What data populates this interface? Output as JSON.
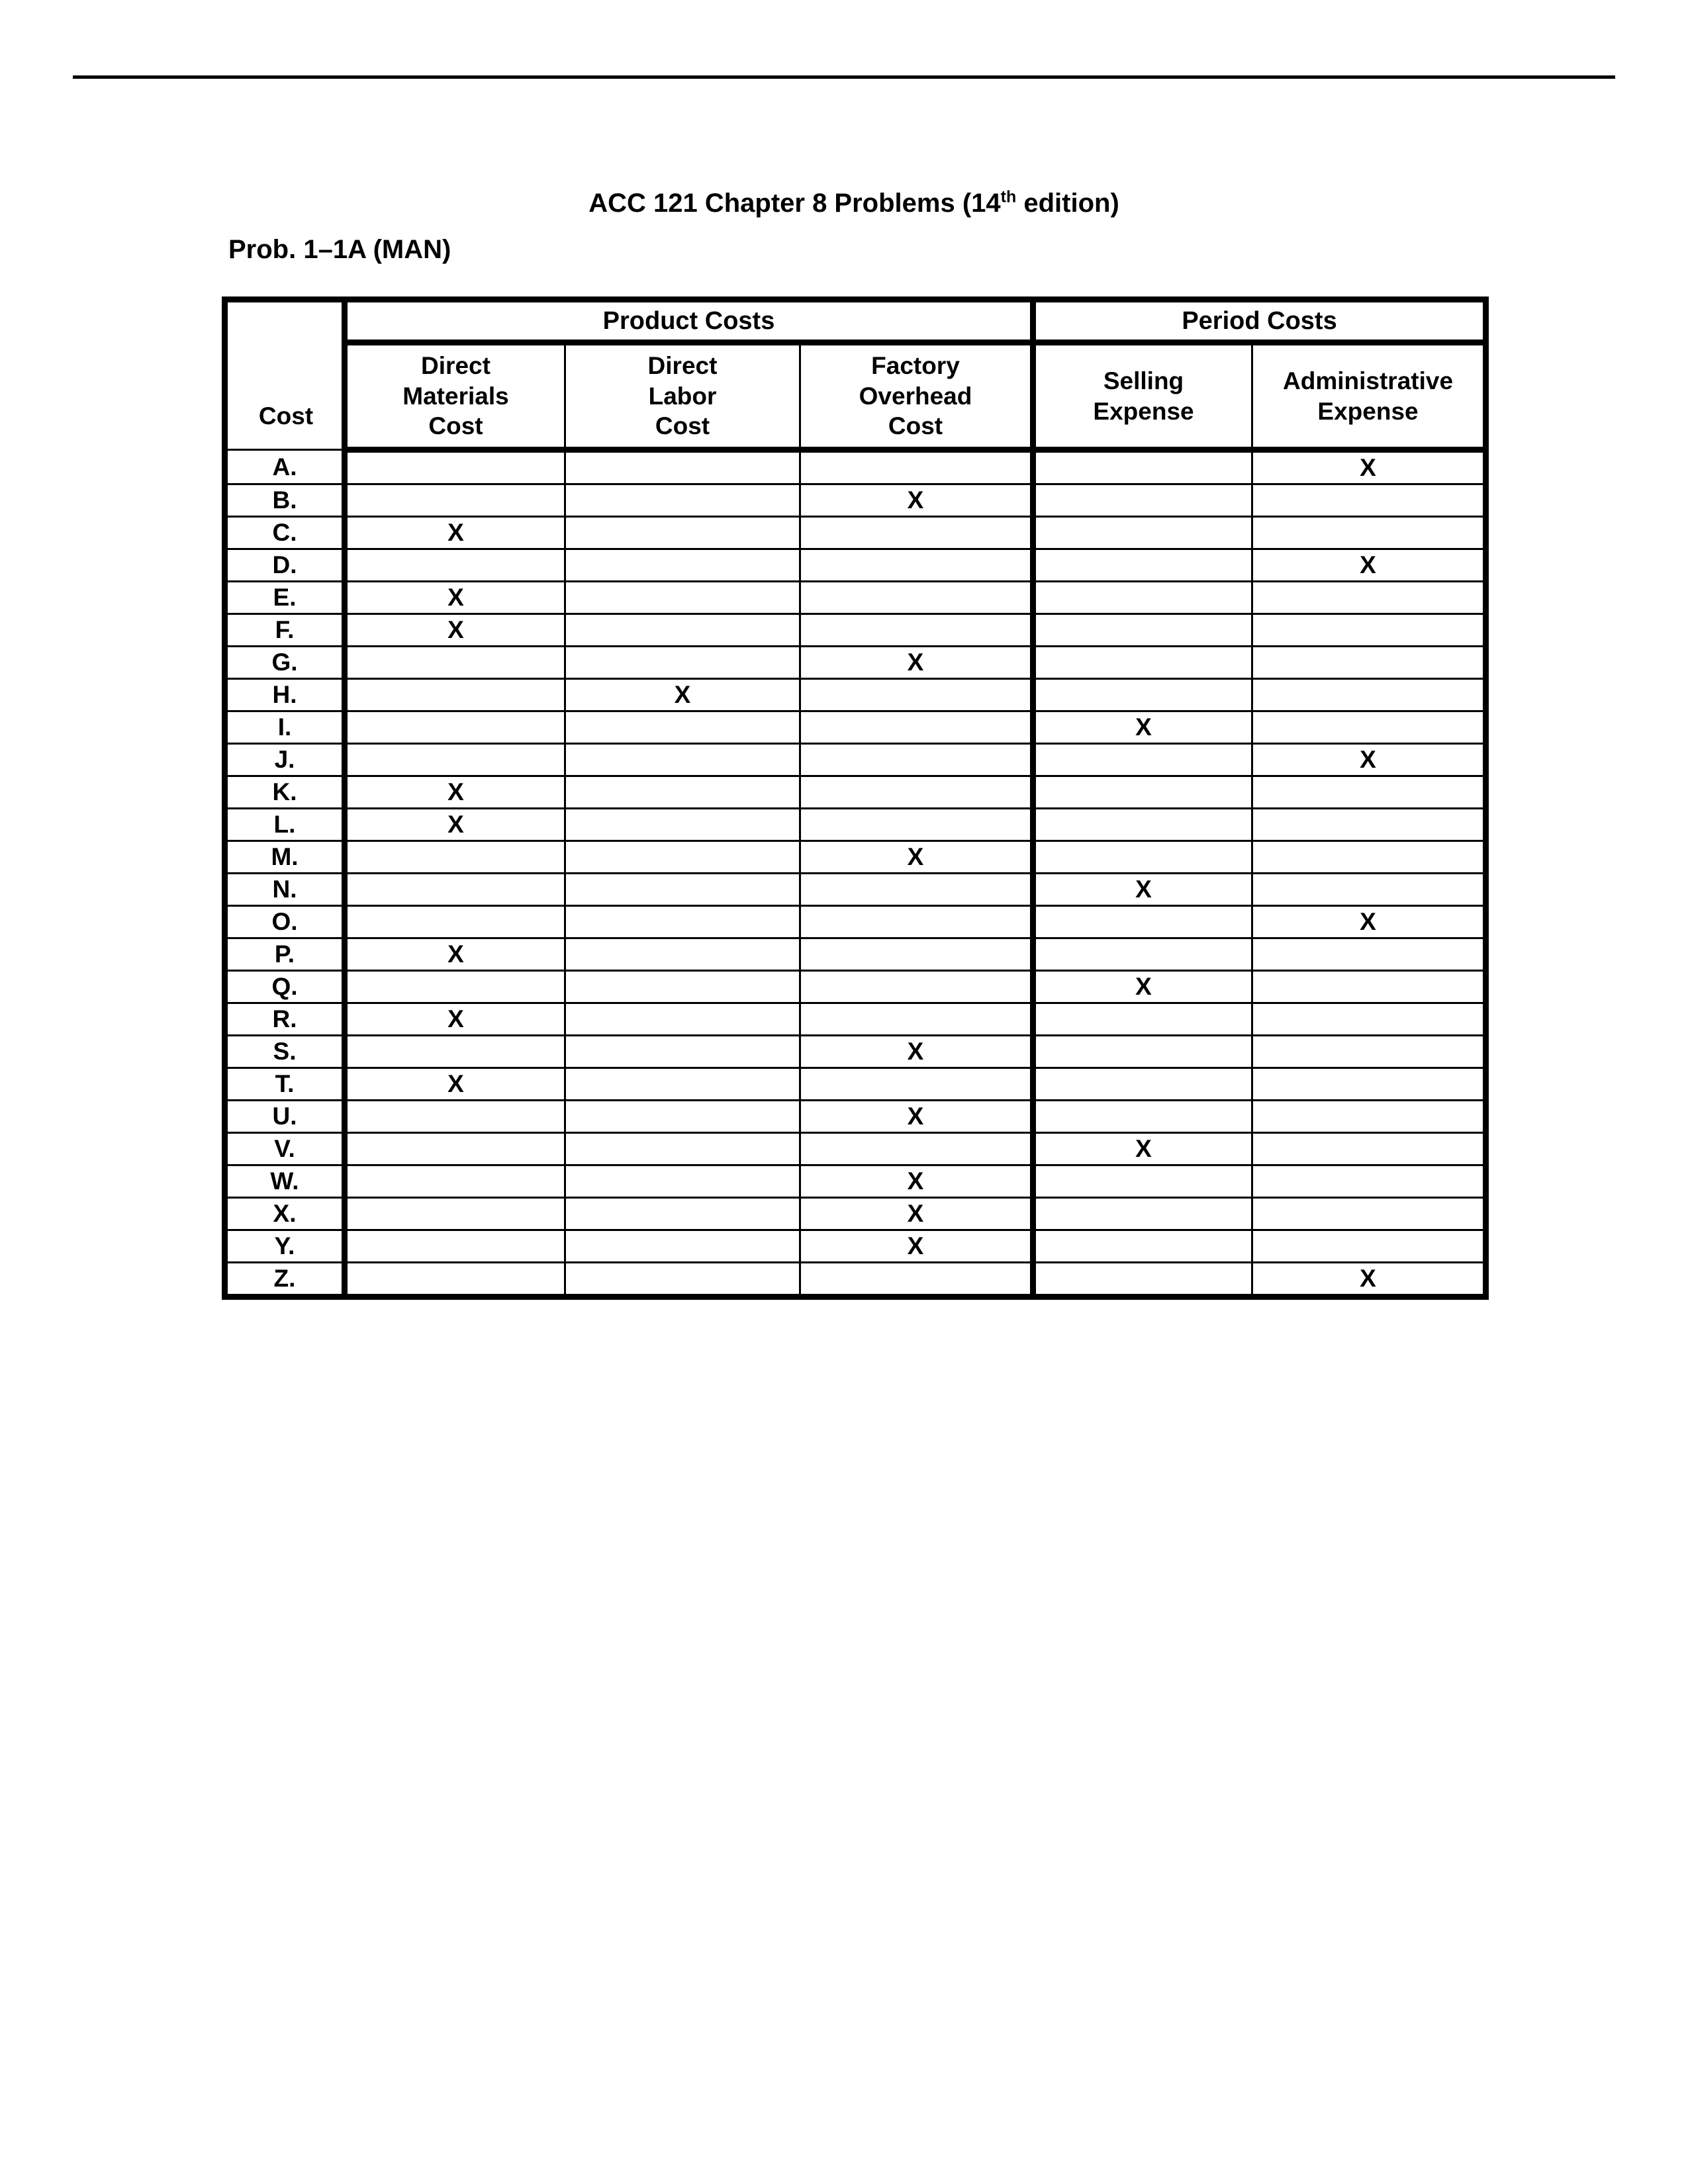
{
  "document": {
    "title_prefix": "ACC 121 Chapter 8 Problems (14",
    "title_superscript": "th",
    "title_suffix": " edition)",
    "problem_label": "Prob. 1–1A (MAN)"
  },
  "table": {
    "group_headers": {
      "corner": "",
      "product_costs": "Product Costs",
      "period_costs": "Period Costs"
    },
    "column_headers": {
      "cost": "Cost",
      "direct_materials": [
        "Direct",
        "Materials",
        "Cost"
      ],
      "direct_labor": [
        "Direct",
        "Labor",
        "Cost"
      ],
      "factory_overhead": [
        "Factory",
        "Overhead",
        "Cost"
      ],
      "selling_expense": [
        "Selling",
        "Expense"
      ],
      "administrative_expense": [
        "Administrative",
        "Expense"
      ]
    },
    "mark": "X",
    "rows": [
      {
        "label": "A.",
        "direct_materials": "",
        "direct_labor": "",
        "factory_overhead": "",
        "selling_expense": "",
        "administrative_expense": "X"
      },
      {
        "label": "B.",
        "direct_materials": "",
        "direct_labor": "",
        "factory_overhead": "X",
        "selling_expense": "",
        "administrative_expense": ""
      },
      {
        "label": "C.",
        "direct_materials": "X",
        "direct_labor": "",
        "factory_overhead": "",
        "selling_expense": "",
        "administrative_expense": ""
      },
      {
        "label": "D.",
        "direct_materials": "",
        "direct_labor": "",
        "factory_overhead": "",
        "selling_expense": "",
        "administrative_expense": "X"
      },
      {
        "label": "E.",
        "direct_materials": "X",
        "direct_labor": "",
        "factory_overhead": "",
        "selling_expense": "",
        "administrative_expense": ""
      },
      {
        "label": "F.",
        "direct_materials": "X",
        "direct_labor": "",
        "factory_overhead": "",
        "selling_expense": "",
        "administrative_expense": ""
      },
      {
        "label": "G.",
        "direct_materials": "",
        "direct_labor": "",
        "factory_overhead": "X",
        "selling_expense": "",
        "administrative_expense": ""
      },
      {
        "label": "H.",
        "direct_materials": "",
        "direct_labor": "X",
        "factory_overhead": "",
        "selling_expense": "",
        "administrative_expense": ""
      },
      {
        "label": "I.",
        "direct_materials": "",
        "direct_labor": "",
        "factory_overhead": "",
        "selling_expense": "X",
        "administrative_expense": ""
      },
      {
        "label": "J.",
        "direct_materials": "",
        "direct_labor": "",
        "factory_overhead": "",
        "selling_expense": "",
        "administrative_expense": "X"
      },
      {
        "label": "K.",
        "direct_materials": "X",
        "direct_labor": "",
        "factory_overhead": "",
        "selling_expense": "",
        "administrative_expense": ""
      },
      {
        "label": "L.",
        "direct_materials": "X",
        "direct_labor": "",
        "factory_overhead": "",
        "selling_expense": "",
        "administrative_expense": ""
      },
      {
        "label": "M.",
        "direct_materials": "",
        "direct_labor": "",
        "factory_overhead": "X",
        "selling_expense": "",
        "administrative_expense": ""
      },
      {
        "label": "N.",
        "direct_materials": "",
        "direct_labor": "",
        "factory_overhead": "",
        "selling_expense": "X",
        "administrative_expense": ""
      },
      {
        "label": "O.",
        "direct_materials": "",
        "direct_labor": "",
        "factory_overhead": "",
        "selling_expense": "",
        "administrative_expense": "X"
      },
      {
        "label": "P.",
        "direct_materials": "X",
        "direct_labor": "",
        "factory_overhead": "",
        "selling_expense": "",
        "administrative_expense": ""
      },
      {
        "label": "Q.",
        "direct_materials": "",
        "direct_labor": "",
        "factory_overhead": "",
        "selling_expense": "X",
        "administrative_expense": ""
      },
      {
        "label": "R.",
        "direct_materials": "X",
        "direct_labor": "",
        "factory_overhead": "",
        "selling_expense": "",
        "administrative_expense": ""
      },
      {
        "label": "S.",
        "direct_materials": "",
        "direct_labor": "",
        "factory_overhead": "X",
        "selling_expense": "",
        "administrative_expense": ""
      },
      {
        "label": "T.",
        "direct_materials": "X",
        "direct_labor": "",
        "factory_overhead": "",
        "selling_expense": "",
        "administrative_expense": ""
      },
      {
        "label": "U.",
        "direct_materials": "",
        "direct_labor": "",
        "factory_overhead": "X",
        "selling_expense": "",
        "administrative_expense": ""
      },
      {
        "label": "V.",
        "direct_materials": "",
        "direct_labor": "",
        "factory_overhead": "",
        "selling_expense": "X",
        "administrative_expense": ""
      },
      {
        "label": "W.",
        "direct_materials": "",
        "direct_labor": "",
        "factory_overhead": "X",
        "selling_expense": "",
        "administrative_expense": ""
      },
      {
        "label": "X.",
        "direct_materials": "",
        "direct_labor": "",
        "factory_overhead": "X",
        "selling_expense": "",
        "administrative_expense": ""
      },
      {
        "label": "Y.",
        "direct_materials": "",
        "direct_labor": "",
        "factory_overhead": "X",
        "selling_expense": "",
        "administrative_expense": ""
      },
      {
        "label": "Z.",
        "direct_materials": "",
        "direct_labor": "",
        "factory_overhead": "",
        "selling_expense": "",
        "administrative_expense": "X"
      }
    ]
  }
}
